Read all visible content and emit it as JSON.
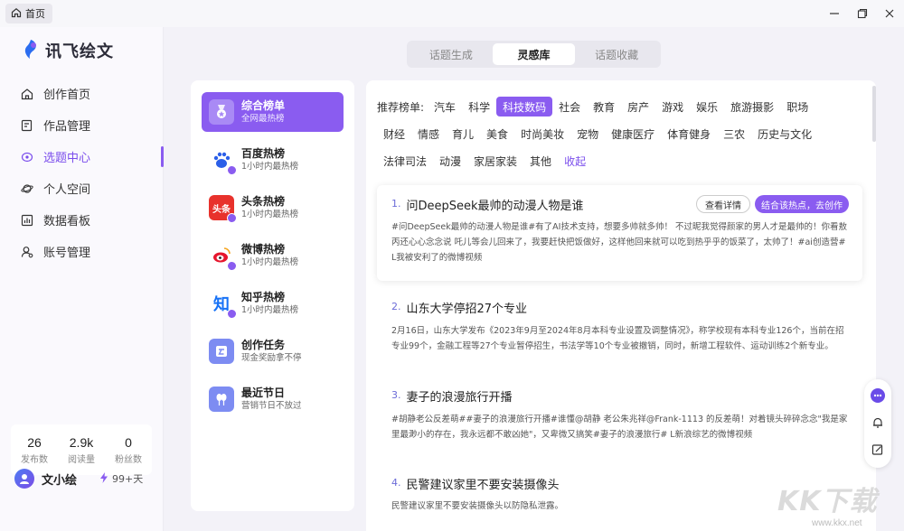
{
  "titlebar": {
    "home_tab": "首页"
  },
  "app": {
    "name": "讯飞绘文"
  },
  "sidebar": {
    "items": [
      {
        "label": "创作首页",
        "icon": "home-icon"
      },
      {
        "label": "作品管理",
        "icon": "edit-doc-icon"
      },
      {
        "label": "选题中心",
        "icon": "target-icon",
        "active": true
      },
      {
        "label": "个人空间",
        "icon": "planet-icon"
      },
      {
        "label": "数据看板",
        "icon": "chart-icon"
      },
      {
        "label": "账号管理",
        "icon": "user-settings-icon"
      }
    ],
    "stats": [
      {
        "value": "26",
        "label": "发布数"
      },
      {
        "value": "2.9k",
        "label": "阅读量"
      },
      {
        "value": "0",
        "label": "粉丝数"
      }
    ],
    "user": {
      "name": "文小绘",
      "days": "99+天"
    }
  },
  "tabs": [
    {
      "label": "话题生成"
    },
    {
      "label": "灵感库",
      "active": true
    },
    {
      "label": "话题收藏"
    }
  ],
  "boards": [
    {
      "title": "综合榜单",
      "sub": "全网最热榜",
      "icon": "medal-icon",
      "active": true
    },
    {
      "title": "百度热榜",
      "sub": "1小时内最热榜",
      "icon": "baidu-icon"
    },
    {
      "title": "头条热榜",
      "sub": "1小时内最热榜",
      "icon": "toutiao-icon",
      "glyph": "头条"
    },
    {
      "title": "微博热榜",
      "sub": "1小时内最热榜",
      "icon": "weibo-icon"
    },
    {
      "title": "知乎热榜",
      "sub": "1小时内最热榜",
      "icon": "zhihu-icon",
      "glyph": "知"
    },
    {
      "title": "创作任务",
      "sub": "现金奖励拿不停",
      "icon": "task-icon"
    },
    {
      "title": "最近节日",
      "sub": "营销节日不放过",
      "icon": "festival-icon"
    }
  ],
  "categories": {
    "label": "推荐榜单:",
    "rows": [
      [
        "汽车",
        "科学",
        "科技数码",
        "社会",
        "教育",
        "房产",
        "游戏",
        "娱乐",
        "旅游摄影",
        "职场"
      ],
      [
        "财经",
        "情感",
        "育儿",
        "美食",
        "时尚美妆",
        "宠物",
        "健康医疗",
        "体育健身",
        "三农",
        "历史与文化"
      ],
      [
        "法律司法",
        "动漫",
        "家居家装",
        "其他"
      ]
    ],
    "active": "科技数码",
    "collapse": "收起"
  },
  "topics": [
    {
      "num": "1.",
      "title": "问DeepSeek最帅的动漫人物是谁",
      "desc": "#问DeepSeek最帅的动漫人物是谁#有了AI技术支持，想要多帅就多帅！ 不过昵我觉得颜家的男人才是最帅的！你看敖丙还心心念念说 吒儿等会儿回来了，我要赶快把饭做好，这样他回来就可以吃到热乎乎的饭菜了，太帅了！#ai创造营# L我被安利了的微博视频",
      "detail_btn": "查看详情",
      "create_btn": "结合该热点，去创作"
    },
    {
      "num": "2.",
      "title": "山东大学停招27个专业",
      "desc": "2月16日，山东大学发布《2023年9月至2024年8月本科专业设置及调整情况》，称学校现有本科专业126个，当前在招专业99个，金融工程等27个专业暂停招生，书法学等10个专业被撤销，同时，新增工程软件、运动训练2个新专业。"
    },
    {
      "num": "3.",
      "title": "妻子的浪漫旅行开播",
      "desc": "#胡静老公反差萌##妻子的浪漫旅行开播#谁懂@胡静 老公朱兆祥@Frank-1113 的反差萌！对着镜头碎碎念念\"我是家里最渺小的存在，我永远都不敢凶她\"，又卑微又搞笑#妻子的浪漫旅行# L新浪综艺的微博视频"
    },
    {
      "num": "4.",
      "title": "民警建议家里不要安装摄像头",
      "desc": "民警建议家里不要安装摄像头以防隐私泄露。"
    }
  ],
  "watermark": {
    "big": "KK下载",
    "small": "www.kkx.net"
  },
  "colors": {
    "accent": "#8a5cf0"
  }
}
